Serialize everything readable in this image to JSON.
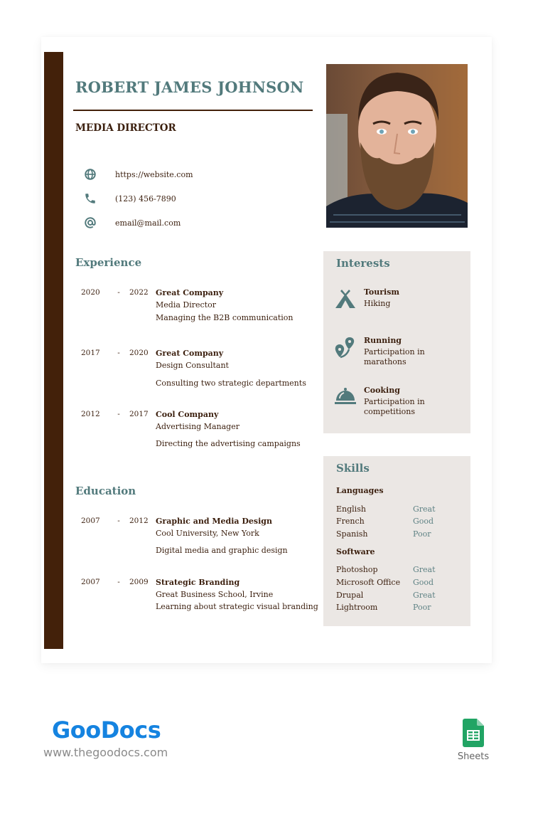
{
  "resume": {
    "name": "ROBERT JAMES JOHNSON",
    "job_title": "MEDIA DIRECTOR",
    "contacts": [
      {
        "icon": "globe-icon",
        "text": "https://website.com"
      },
      {
        "icon": "phone-icon",
        "text": "(123) 456-7890"
      },
      {
        "icon": "at-icon",
        "text": "email@mail.com"
      }
    ],
    "photo_alt": "Portrait of bearded man",
    "experience": {
      "title": "Experience",
      "items": [
        {
          "start": "2020",
          "sep": "-",
          "end": "2022",
          "org": "Great Company",
          "role": "Media Director",
          "desc": "Managing the B2B communication"
        },
        {
          "start": "2017",
          "sep": "-",
          "end": "2020",
          "org": "Great Company",
          "role": "Design Consultant",
          "desc": "Consulting two strategic departments"
        },
        {
          "start": "2012",
          "sep": "-",
          "end": "2017",
          "org": "Cool Company",
          "role": "Advertising Manager",
          "desc": "Directing the advertising campaigns"
        }
      ]
    },
    "education": {
      "title": "Education",
      "items": [
        {
          "start": "2007",
          "sep": "-",
          "end": "2012",
          "org": "Graphic and Media Design",
          "role": "Cool University, New York",
          "desc": "Digital media and graphic design"
        },
        {
          "start": "2007",
          "sep": "-",
          "end": "2009",
          "org": "Strategic Branding",
          "role": "Great Business School, Irvine",
          "desc": "Learning about strategic visual branding"
        }
      ]
    },
    "interests": {
      "title": "Interests",
      "items": [
        {
          "icon": "tent-icon",
          "name": "Tourism",
          "desc": "Hiking"
        },
        {
          "icon": "route-pins-icon",
          "name": "Running",
          "desc": "Participation in marathons"
        },
        {
          "icon": "cloche-icon",
          "name": "Cooking",
          "desc": "Participation in competitions"
        }
      ]
    },
    "skills": {
      "title": "Skills",
      "groups": [
        {
          "name": "Languages",
          "items": [
            {
              "skill": "English",
              "level": "Great"
            },
            {
              "skill": "French",
              "level": "Good"
            },
            {
              "skill": "Spanish",
              "level": "Poor"
            }
          ]
        },
        {
          "name": "Software",
          "items": [
            {
              "skill": "Photoshop",
              "level": "Great"
            },
            {
              "skill": "Microsoft Office",
              "level": "Good"
            },
            {
              "skill": "Drupal",
              "level": "Great"
            },
            {
              "skill": "Lightroom",
              "level": "Poor"
            }
          ]
        }
      ]
    }
  },
  "footer": {
    "brand": "GooDocs",
    "url": "www.thegoodocs.com",
    "app_label": "Sheets"
  },
  "colors": {
    "accent_teal": "#527a7c",
    "dark_brown": "#43210a",
    "panel_bg": "#ebe7e4",
    "brand_blue": "#1583e0",
    "sheets_green": "#21a464"
  }
}
